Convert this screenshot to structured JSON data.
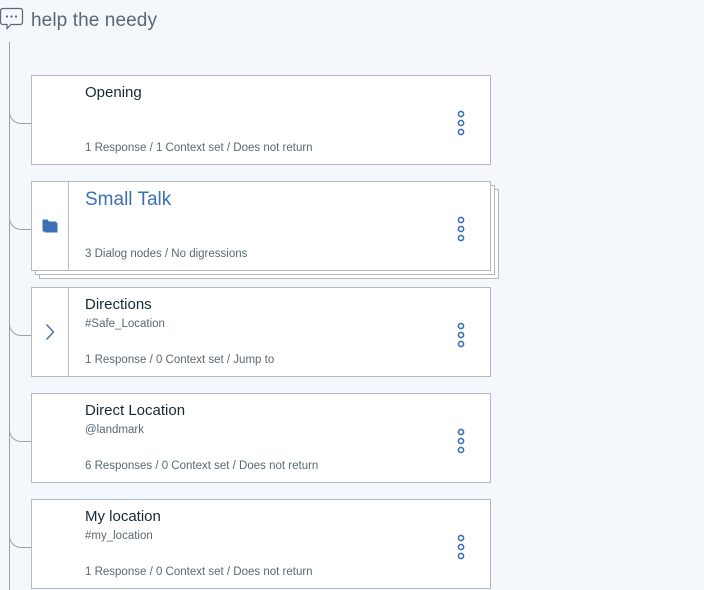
{
  "root": {
    "title": "help the needy",
    "icon": "chat-bubble-icon"
  },
  "colors": {
    "accent": "#3d70b2",
    "menu_dots": "#3d70b2",
    "folder": "#3d70b2",
    "chevron": "#3d70b2",
    "border": "#b3bbc1",
    "background": "#f4f7fb"
  },
  "nodes": [
    {
      "title": "Opening",
      "condition": "",
      "summary": "1 Response / 1 Context set / Does not return",
      "gutter_icon": "",
      "menu_icon": "overflow-menu-icon"
    },
    {
      "title": "Small Talk",
      "condition": "",
      "summary": "3 Dialog nodes / No digressions",
      "gutter_icon": "folder-icon",
      "menu_icon": "overflow-menu-icon"
    },
    {
      "title": "Directions",
      "condition": "#Safe_Location",
      "summary": "1 Response / 0 Context set / Jump to",
      "gutter_icon": "chevron-right-icon",
      "menu_icon": "overflow-menu-icon"
    },
    {
      "title": "Direct Location",
      "condition": "@landmark",
      "summary": "6 Responses / 0 Context set / Does not return",
      "gutter_icon": "",
      "menu_icon": "overflow-menu-icon"
    },
    {
      "title": "My location",
      "condition": "#my_location",
      "summary": "1 Response / 0 Context set / Does not return",
      "gutter_icon": "",
      "menu_icon": "overflow-menu-icon"
    }
  ]
}
